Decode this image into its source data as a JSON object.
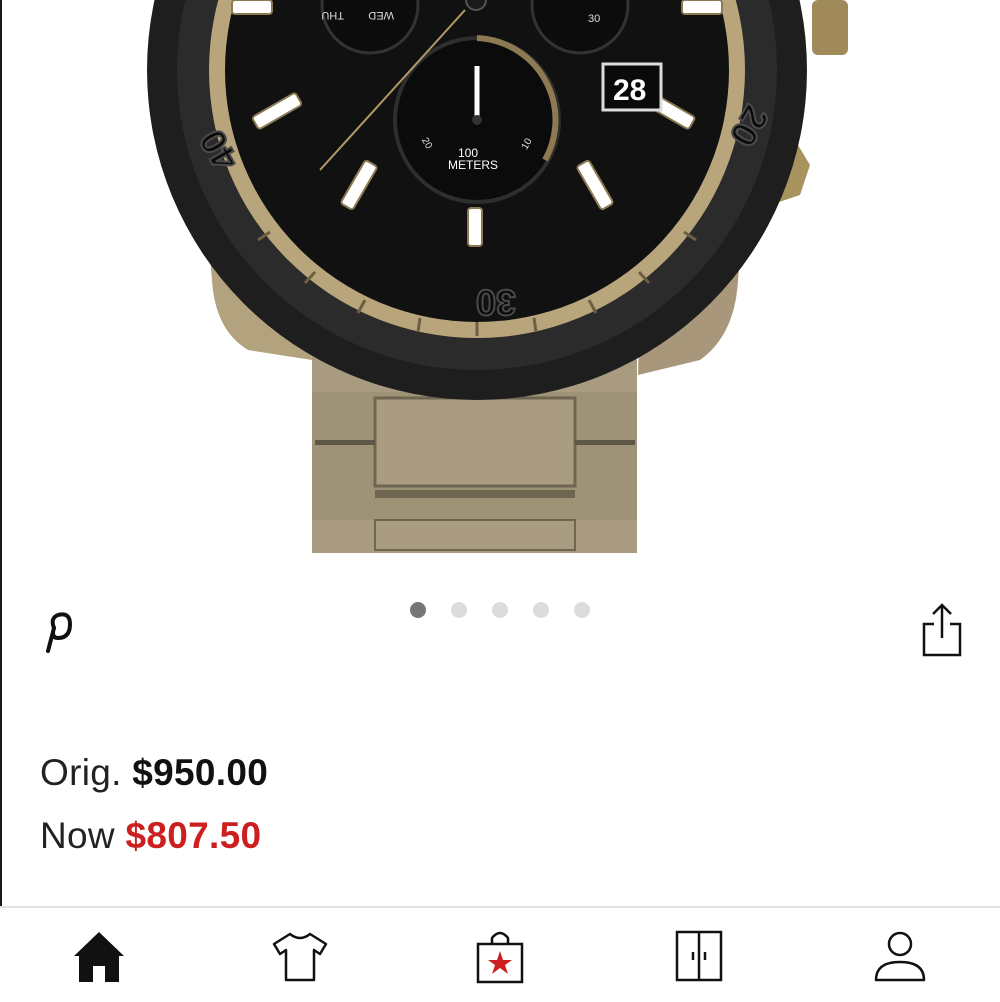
{
  "product": {
    "image_alt": "Chronograph watch with black dial and bronze-tone bracelet",
    "dial_text": {
      "subdial_label_1": "100",
      "subdial_label_2": "METERS",
      "date": "28",
      "bezel_30": "30",
      "bezel_40": "40",
      "bezel_20": "20",
      "day_thu": "THU",
      "day_wed": "WED",
      "subdial_30": "30",
      "subdial_20": "20",
      "subdial_10": "10"
    }
  },
  "carousel": {
    "total": 5,
    "active_index": 0
  },
  "pricing": {
    "orig_label": "Orig.",
    "orig_amount": "$950.00",
    "now_label": "Now",
    "now_amount": "$807.50",
    "sale_color": "#cc1f1f"
  },
  "icons": {
    "pinterest": "pinterest-icon",
    "share": "share-icon",
    "home": "home-icon",
    "shop": "shirt-icon",
    "bag": "shopping-bag-star-icon",
    "wallet": "wallet-icon",
    "account": "person-icon"
  }
}
